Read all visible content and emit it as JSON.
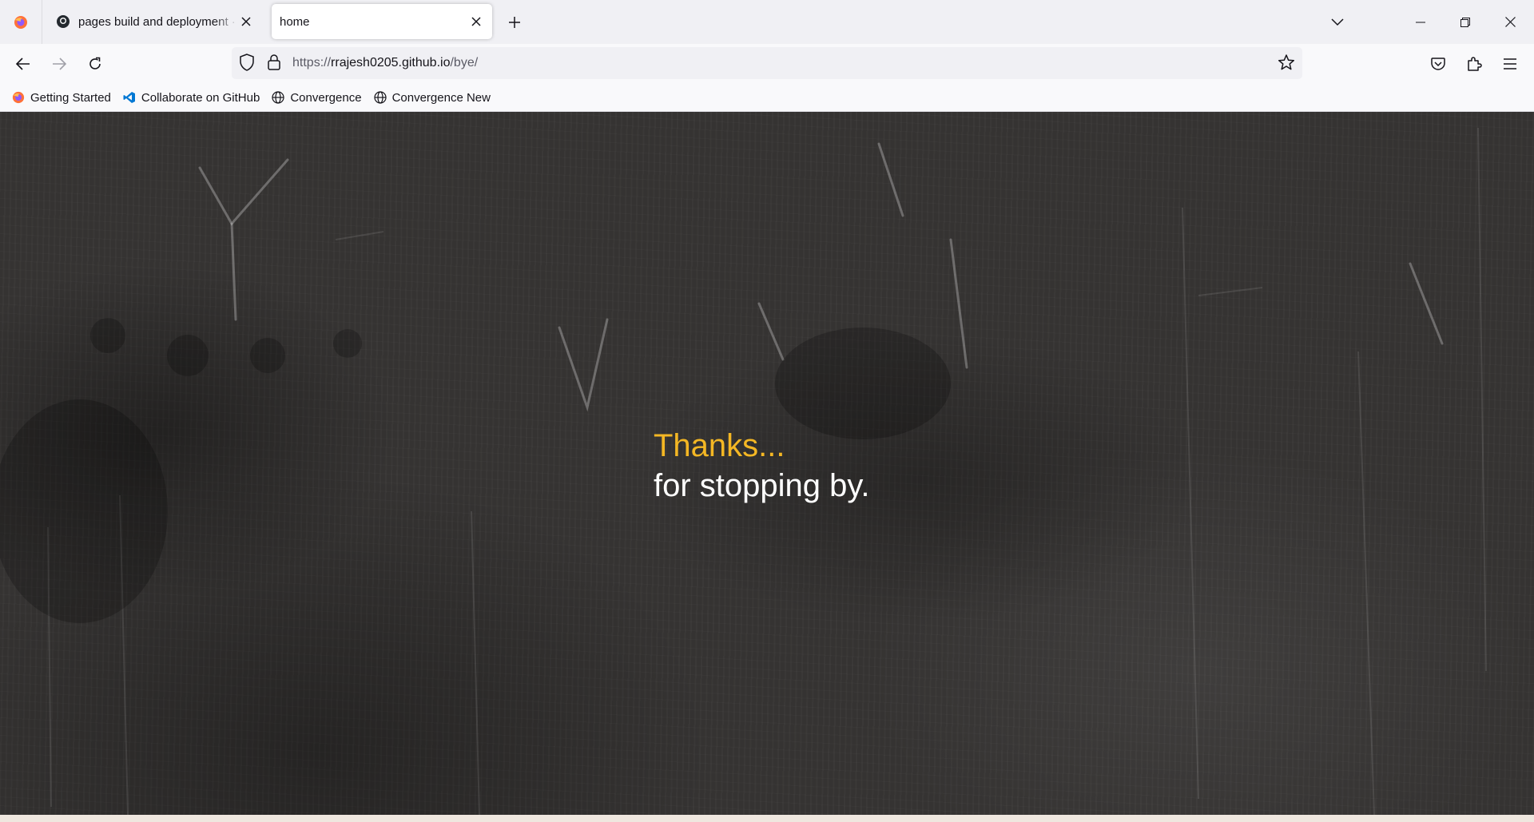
{
  "browser": {
    "tabs": [
      {
        "title": "pages build and deployment · r",
        "active": false,
        "icon": "github-icon"
      },
      {
        "title": "home",
        "active": true,
        "icon": null
      }
    ],
    "new_tab_icon": "plus-icon",
    "list_all_tabs_icon": "chevron-down-icon",
    "window_controls": [
      "minimize-icon",
      "restore-icon",
      "close-icon"
    ]
  },
  "navbar": {
    "url_scheme": "https://",
    "url_host": "rrajesh0205.github.io",
    "url_path": "/bye/",
    "icons": [
      "back-icon",
      "forward-icon",
      "reload-icon",
      "shield-icon",
      "lock-icon",
      "star-icon",
      "pocket-icon",
      "extensions-icon",
      "hamburger-menu-icon"
    ]
  },
  "bookmarks": [
    {
      "label": "Getting Started",
      "icon": "firefox-icon"
    },
    {
      "label": "Collaborate on GitHub",
      "icon": "vscode-icon"
    },
    {
      "label": "Convergence",
      "icon": "globe-icon"
    },
    {
      "label": "Convergence New",
      "icon": "globe-icon"
    }
  ],
  "page": {
    "heading": "Thanks...",
    "subheading": "for stopping by.",
    "heading_color": "#f4b724",
    "background": "chalkboard"
  }
}
